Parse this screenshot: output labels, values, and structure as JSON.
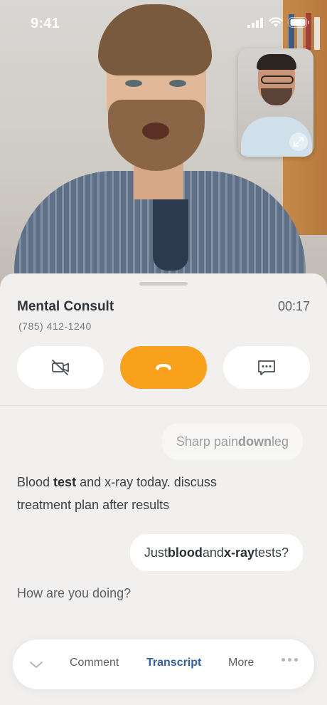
{
  "status_bar": {
    "time": "9:41"
  },
  "call": {
    "title": "Mental Consult",
    "phone": "(785) 412-1240",
    "timer": "00:17"
  },
  "controls": {
    "video_icon": "video-off-icon",
    "end_icon": "phone-hangup-icon",
    "message_icon": "chat-bubble-icon",
    "end_color": "#f9a11b"
  },
  "transcript": [
    {
      "side": "right",
      "pre": "Sharp pain ",
      "bold": "down",
      "post": " leg"
    },
    {
      "side": "left",
      "pre": "Blood ",
      "bold": "test",
      "post": " and x-ray today. discuss",
      "line2": "treatment plan after results"
    },
    {
      "side": "right",
      "pre": "Just ",
      "bold": "blood",
      "mid": " and ",
      "bold2": "x-ray",
      "post": " tests?"
    },
    {
      "side": "left",
      "text": "How are you doing?"
    }
  ],
  "bottom_bar": {
    "tabs": [
      "Comment",
      "Transcript",
      "More"
    ],
    "active_tab": "Transcript",
    "active_color": "#2f5fa7"
  }
}
